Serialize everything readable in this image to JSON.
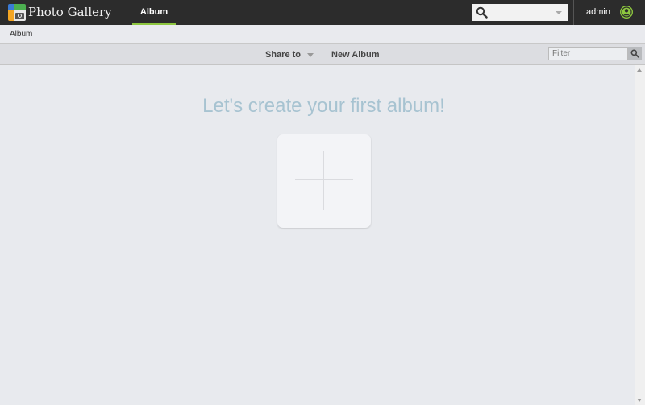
{
  "app": {
    "title": "Photo Gallery",
    "logo_icon": "photo-gallery-logo-icon"
  },
  "topbar": {
    "tabs": [
      {
        "label": "Album",
        "active": true
      }
    ],
    "search": {
      "placeholder": "",
      "value": "",
      "icon": "search-icon"
    },
    "user": {
      "name": "admin",
      "avatar_icon": "user-avatar-icon"
    },
    "accent_color": "#8dc63f"
  },
  "breadcrumb": {
    "items": [
      "Album"
    ]
  },
  "toolbar": {
    "share_label": "Share to",
    "new_album_label": "New Album",
    "filter": {
      "placeholder": "Filter",
      "value": ""
    }
  },
  "main": {
    "headline": "Let's create your first album!",
    "add_icon": "plus-icon",
    "headline_color": "#a7c3d1"
  }
}
